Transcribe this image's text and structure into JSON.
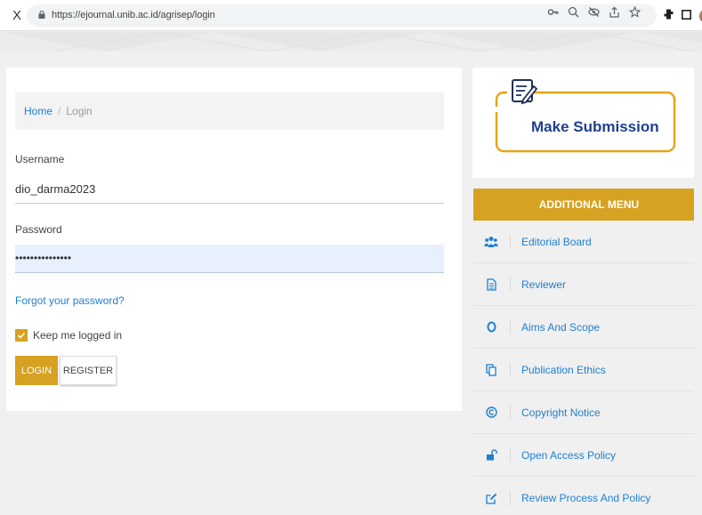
{
  "browser": {
    "close_glyph": "X",
    "url": "https://ejournal.unib.ac.id/agrisep/login"
  },
  "breadcrumb": {
    "home": "Home",
    "separator": "/",
    "current": "Login"
  },
  "login": {
    "username_label": "Username",
    "username_value": "dio_darma2023",
    "password_label": "Password",
    "password_value": "•••••••••••••••",
    "forgot": "Forgot your password?",
    "remember": "Keep me logged in",
    "remember_checked": true,
    "login_btn": "LOGIN",
    "register_btn": "REGISTER"
  },
  "sidebar": {
    "submission_label": "Make Submission",
    "menu_title": "ADDITIONAL MENU",
    "items": [
      {
        "label": "Editorial Board",
        "icon": "users-icon"
      },
      {
        "label": "Reviewer",
        "icon": "document-icon"
      },
      {
        "label": "Aims And Scope",
        "icon": "circle-icon"
      },
      {
        "label": "Publication Ethics",
        "icon": "copy-icon"
      },
      {
        "label": "Copyright Notice",
        "icon": "copyright-icon"
      },
      {
        "label": "Open Access Policy",
        "icon": "unlock-icon"
      },
      {
        "label": "Review Process And Policy",
        "icon": "edit-icon"
      }
    ]
  },
  "colors": {
    "accent": "#d7a121",
    "link": "#1e7fd1",
    "brand_navy": "#1f3f8c"
  }
}
